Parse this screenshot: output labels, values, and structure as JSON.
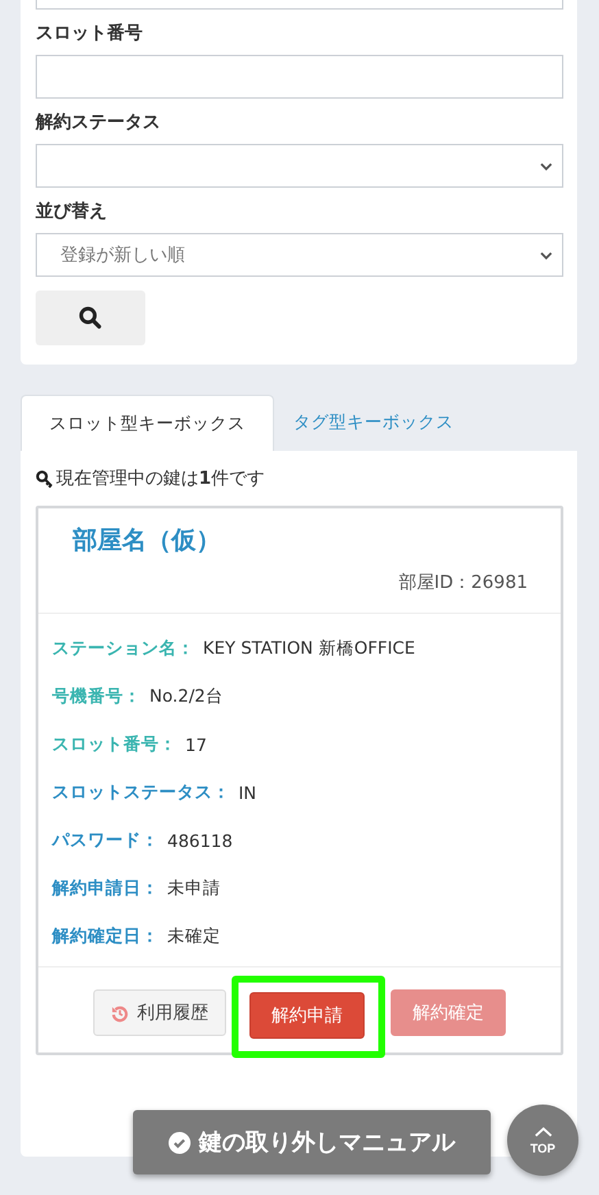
{
  "filters": [
    {
      "label": "スロット番号",
      "kind": "text"
    },
    {
      "label": "解約ステータス",
      "kind": "select"
    },
    {
      "label": "並び替え",
      "kind": "select",
      "value": "登録が新しい順"
    }
  ],
  "tabs": [
    {
      "label": "スロット型キーボックス",
      "selected": true
    },
    {
      "label": "タグ型キーボックス",
      "selected": false
    }
  ],
  "key_count": "現在管理中の鍵は**1**件です",
  "card": {
    "title": "部屋名（仮）",
    "room_id": "部屋ID：26981",
    "rows": [
      {
        "label": "ステーション名：",
        "value": "KEY STATION 新橋OFFICE",
        "color": "#3ab5b0"
      },
      {
        "label": "号機番号：",
        "value": "No.2/2台",
        "color": "#3ab5b0"
      },
      {
        "label": "スロット番号：",
        "value": "17",
        "color": "#3ab5b0"
      },
      {
        "label": "スロットステータス：",
        "value": "IN",
        "color": "#2d8ec4"
      },
      {
        "label": "パスワード：",
        "value": "486118",
        "color": "#2d8ec4"
      },
      {
        "label": "解約申請日：",
        "value": "未申請",
        "color": "#2d8ec4"
      },
      {
        "label": "解約確定日：",
        "value": "未確定",
        "color": "#2d8ec4"
      }
    ],
    "buttons": [
      {
        "label": "利用履歴",
        "kind": "history",
        "disabled": false,
        "highlighted": false
      },
      {
        "label": "解約申請",
        "kind": "danger",
        "disabled": false,
        "highlighted": true
      },
      {
        "label": "解約確定",
        "kind": "danger",
        "disabled": true,
        "highlighted": false
      }
    ]
  },
  "manual_button": "鍵の取り外しマニュアル",
  "top_button": "TOP"
}
